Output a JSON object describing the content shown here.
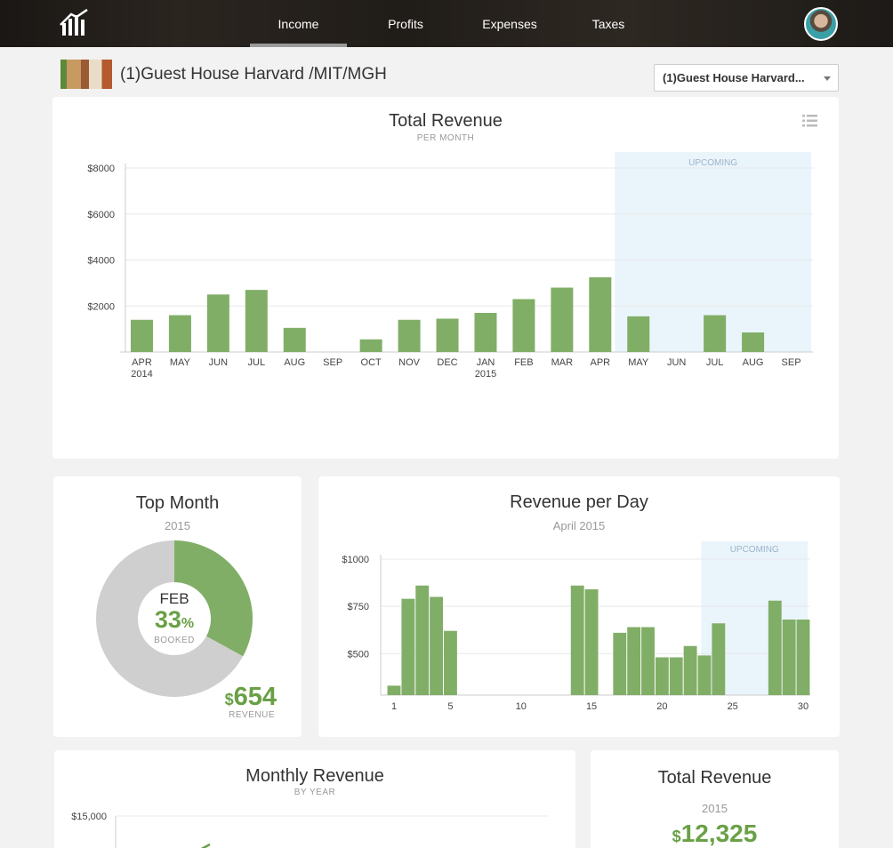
{
  "nav": {
    "items": [
      {
        "label": "Income",
        "active": true
      },
      {
        "label": "Profits",
        "active": false
      },
      {
        "label": "Expenses",
        "active": false
      },
      {
        "label": "Taxes",
        "active": false
      }
    ]
  },
  "property": {
    "title": "(1)Guest House Harvard /MIT/MGH",
    "select_value": "(1)Guest House Harvard..."
  },
  "total_revenue_card": {
    "title": "Total Revenue",
    "subtitle": "PER MONTH",
    "upcoming_label": "UPCOMING"
  },
  "top_month_card": {
    "title": "Top Month",
    "year": "2015",
    "month": "FEB",
    "percent": "33",
    "percent_sign": "%",
    "booked_label": "BOOKED",
    "currency": "$",
    "revenue": "654",
    "revenue_label": "REVENUE"
  },
  "revenue_per_day_card": {
    "title": "Revenue per Day",
    "subtitle": "April 2015",
    "upcoming_label": "UPCOMING"
  },
  "monthly_revenue_card": {
    "title": "Monthly Revenue",
    "subtitle": "BY YEAR",
    "y_tick": "$15,000"
  },
  "total_revenue_year_card": {
    "title": "Total Revenue",
    "year": "2015",
    "currency": "$",
    "amount": "12,325"
  },
  "colors": {
    "bar": "#80ae66",
    "accent": "#6aa046",
    "upcoming": "#eaf4fb",
    "donut_rest": "#cfcfcf"
  },
  "chart_data": [
    {
      "type": "bar",
      "title": "Total Revenue",
      "subtitle": "PER MONTH",
      "categories": [
        "APR",
        "MAY",
        "JUN",
        "JUL",
        "AUG",
        "SEP",
        "OCT",
        "NOV",
        "DEC",
        "JAN",
        "FEB",
        "MAR",
        "APR",
        "MAY",
        "JUN",
        "JUL",
        "AUG",
        "SEP"
      ],
      "category_years": [
        "2014",
        "",
        "",
        "",
        "",
        "",
        "",
        "",
        "",
        "2015",
        "",
        "",
        "",
        "",
        "",
        "",
        "",
        ""
      ],
      "values": [
        1400,
        1600,
        2500,
        2700,
        1050,
        0,
        550,
        1400,
        1450,
        1700,
        2300,
        2800,
        3250,
        1550,
        0,
        1600,
        850,
        0
      ],
      "ylim": [
        0,
        8000
      ],
      "yticks": [
        2000,
        4000,
        6000,
        8000
      ],
      "ytick_labels": [
        "$2000",
        "$4000",
        "$6000",
        "$8000"
      ],
      "upcoming_from_index": 13,
      "grid": true
    },
    {
      "type": "pie",
      "title": "Top Month",
      "slices": [
        {
          "label": "BOOKED",
          "value": 33
        },
        {
          "label": "",
          "value": 67
        }
      ]
    },
    {
      "type": "bar",
      "title": "Revenue per Day",
      "subtitle": "April 2015",
      "x": [
        1,
        2,
        3,
        4,
        5,
        6,
        7,
        8,
        9,
        10,
        11,
        12,
        13,
        14,
        15,
        16,
        17,
        18,
        19,
        20,
        21,
        22,
        23,
        24,
        25,
        26,
        27,
        28,
        29,
        30
      ],
      "values": [
        330,
        790,
        860,
        800,
        620,
        0,
        0,
        0,
        0,
        0,
        0,
        0,
        0,
        860,
        840,
        0,
        610,
        640,
        640,
        480,
        480,
        540,
        490,
        660,
        0,
        0,
        0,
        780,
        680,
        680
      ],
      "xticks": [
        1,
        5,
        10,
        15,
        20,
        25,
        30
      ],
      "ylim": [
        280,
        1000
      ],
      "yticks": [
        500,
        750,
        1000
      ],
      "ytick_labels": [
        "$500",
        "$750",
        "$1000"
      ],
      "upcoming_from_day": 24,
      "grid": true
    }
  ]
}
